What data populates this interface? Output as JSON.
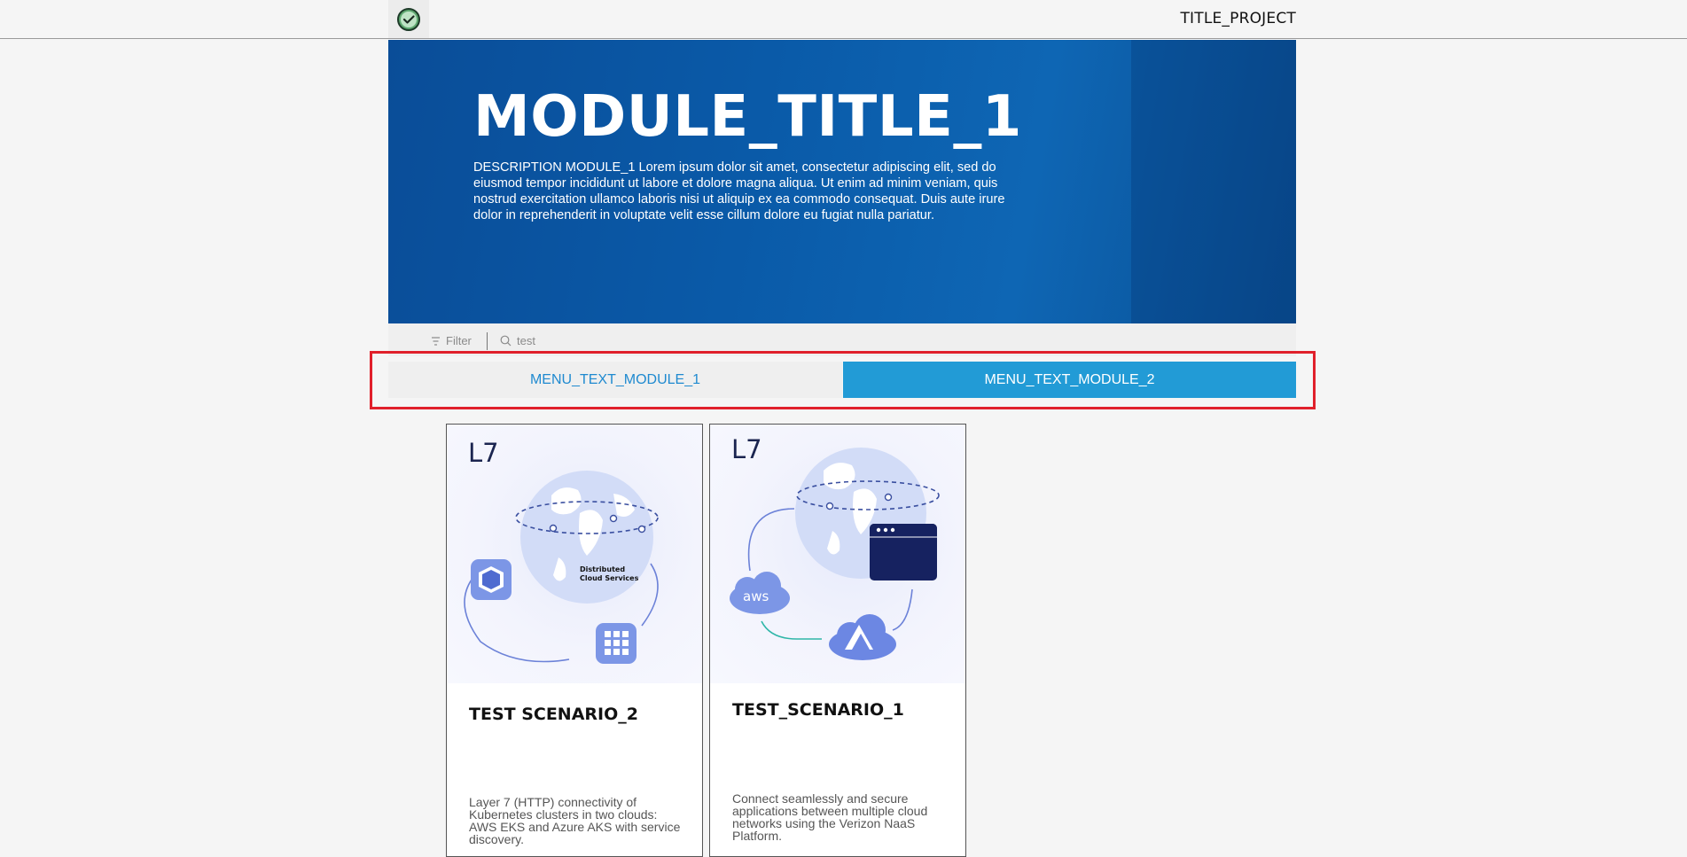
{
  "header": {
    "project_title": "TITLE_PROJECT",
    "logo_icon": "check-circle-logo"
  },
  "hero": {
    "title": "MODULE_TITLE_1",
    "description": "DESCRIPTION MODULE_1 Lorem ipsum dolor sit amet, consectetur adipiscing elit, sed do eiusmod tempor incididunt ut labore et dolore magna aliqua. Ut enim ad minim veniam, quis nostrud exercitation ullamco laboris nisi ut aliquip ex ea commodo consequat. Duis aute irure dolor in reprehenderit in voluptate velit esse cillum dolore eu fugiat nulla pariatur."
  },
  "toolbar": {
    "filter_label": "Filter",
    "search_value": "test"
  },
  "tabs": [
    {
      "label": "MENU_TEXT_MODULE_1",
      "active": false
    },
    {
      "label": "MENU_TEXT_MODULE_2",
      "active": true
    }
  ],
  "cards": [
    {
      "badge": "L7",
      "art_label": "Distributed Cloud Services",
      "title": "TEST SCENARIO_2",
      "description": "Layer 7 (HTTP) connectivity of Kubernetes clusters in two clouds: AWS EKS and Azure AKS with service discovery."
    },
    {
      "badge": "L7",
      "art_label": "aws",
      "title": "TEST_SCENARIO_1",
      "description": "Connect seamlessly and secure applications between multiple cloud networks using the Verizon NaaS Platform."
    }
  ],
  "colors": {
    "accent": "#229bd6",
    "hero_blue": "#0a5aa8",
    "highlight_red": "#e0202b"
  }
}
